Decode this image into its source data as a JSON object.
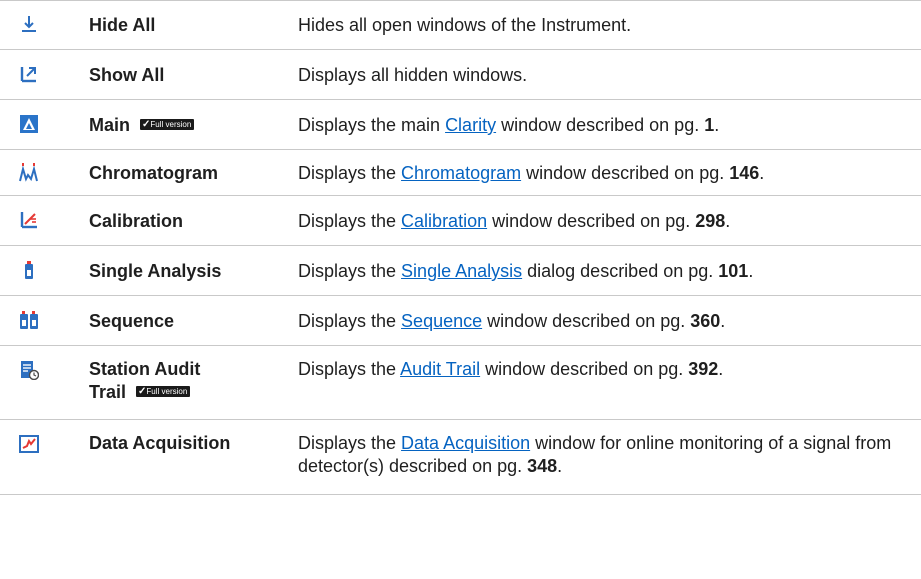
{
  "rows": [
    {
      "name": "Hide All",
      "icon": "hide-all-icon",
      "desc_pre": "Hides all open windows of the Instrument.",
      "link": "",
      "desc_mid": "",
      "page": "",
      "desc_end": ""
    },
    {
      "name": "Show All",
      "icon": "show-all-icon",
      "desc_pre": "Displays all hidden windows.",
      "link": "",
      "desc_mid": "",
      "page": "",
      "desc_end": ""
    },
    {
      "name": "Main",
      "icon": "main-window-icon",
      "badge": "Full version",
      "desc_pre": "Displays the main ",
      "link": "Clarity",
      "desc_mid": " window described on pg. ",
      "page": "1",
      "desc_end": "."
    },
    {
      "name": "Chromatogram",
      "icon": "chromatogram-icon",
      "desc_pre": "Displays the ",
      "link": "Chromatogram",
      "desc_mid": " window described on pg. ",
      "page": "146",
      "desc_end": "."
    },
    {
      "name": "Calibration",
      "icon": "calibration-icon",
      "desc_pre": "Displays the ",
      "link": "Calibration",
      "desc_mid": " window described on pg. ",
      "page": "298",
      "desc_end": "."
    },
    {
      "name": "Single Analysis",
      "icon": "single-analysis-icon",
      "desc_pre": "Displays the ",
      "link": "Single Analysis",
      "desc_mid": " dialog described on pg. ",
      "page": "101",
      "desc_end": "."
    },
    {
      "name": "Sequence",
      "icon": "sequence-icon",
      "desc_pre": "Displays the ",
      "link": "Sequence",
      "desc_mid": " window described on pg. ",
      "page": "360",
      "desc_end": "."
    },
    {
      "name_line1": "Station Audit",
      "name_line2": "Trail",
      "icon": "audit-trail-icon",
      "badge": "Full version",
      "desc_pre": "Displays the ",
      "link": "Audit Trail",
      "desc_mid": " window described on pg. ",
      "page": "392",
      "desc_end": "."
    },
    {
      "name": "Data Acquisition",
      "icon": "data-acquisition-icon",
      "desc_pre": "Displays the ",
      "link": "Data Acquisition",
      "desc_mid": " window for online monitoring of a signal from detector(s) described on pg. ",
      "page": "348",
      "desc_end": "."
    }
  ]
}
